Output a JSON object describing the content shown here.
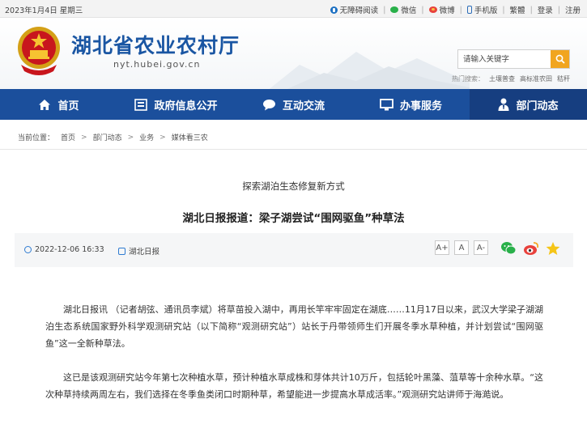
{
  "topbar": {
    "date": "2023年1月4日 星期三",
    "links": [
      {
        "label": "无障碍阅读",
        "icon": "accessibility-icon"
      },
      {
        "label": "微信",
        "icon": "wechat-icon"
      },
      {
        "label": "微博",
        "icon": "weibo-icon"
      },
      {
        "label": "手机版",
        "icon": "phone-icon"
      },
      {
        "label": "繁體",
        "icon": ""
      },
      {
        "label": "登录",
        "icon": ""
      },
      {
        "label": "注册",
        "icon": ""
      }
    ]
  },
  "header": {
    "site_name": "湖北省农业农村厅",
    "site_url": "nyt.hubei.gov.cn",
    "search_placeholder": "请输入关键字",
    "hot_label": "热门搜索：",
    "hot_items": [
      "土壤普查",
      "高标准农田",
      "秸秆"
    ]
  },
  "nav": [
    {
      "label": "首页",
      "icon": "home-icon"
    },
    {
      "label": "政府信息公开",
      "icon": "info-disclosure-icon"
    },
    {
      "label": "互动交流",
      "icon": "chat-bubble-icon"
    },
    {
      "label": "办事服务",
      "icon": "monitor-icon"
    },
    {
      "label": "部门动态",
      "icon": "department-icon"
    }
  ],
  "breadcrumb": {
    "label": "当前位置：",
    "items": [
      "首页",
      "部门动态",
      "业务",
      "媒体看三农"
    ]
  },
  "article": {
    "subtitle": "探索湖泊生态修复新方式",
    "title": "湖北日报报道：梁子湖尝试“围网驱鱼”种草法",
    "date": "2022-12-06 16:33",
    "source": "湖北日报",
    "font_buttons": [
      "A+",
      "A",
      "A-"
    ],
    "share_icons": [
      "wechat-share-icon",
      "weibo-share-icon",
      "favorite-icon"
    ],
    "paragraphs": [
      "湖北日报讯   （记者胡弦、通讯员李斌）将草苗投入湖中，再用长竿牢牢固定在湖底……11月17日以来，武汉大学梁子湖湖泊生态系统国家野外科学观测研究站（以下简称“观测研究站”）站长于丹带领师生们开展冬季水草种植，并计划尝试“围网驱鱼”这一全新种草法。",
      "这已是该观测研究站今年第七次种植水草，预计种植水草成株和芽体共计10万斤，包括轮叶黑藻、菹草等十余种水草。“这次种草持续两周左右，我们选择在冬季鱼类闭口时期种草，希望能进一步提高水草成活率。”观测研究站讲师于海澔说。"
    ]
  },
  "colors": {
    "nav_bg": "#1b4f9c",
    "brand_text": "#1a56a3",
    "search_button": "#f1a51f"
  }
}
